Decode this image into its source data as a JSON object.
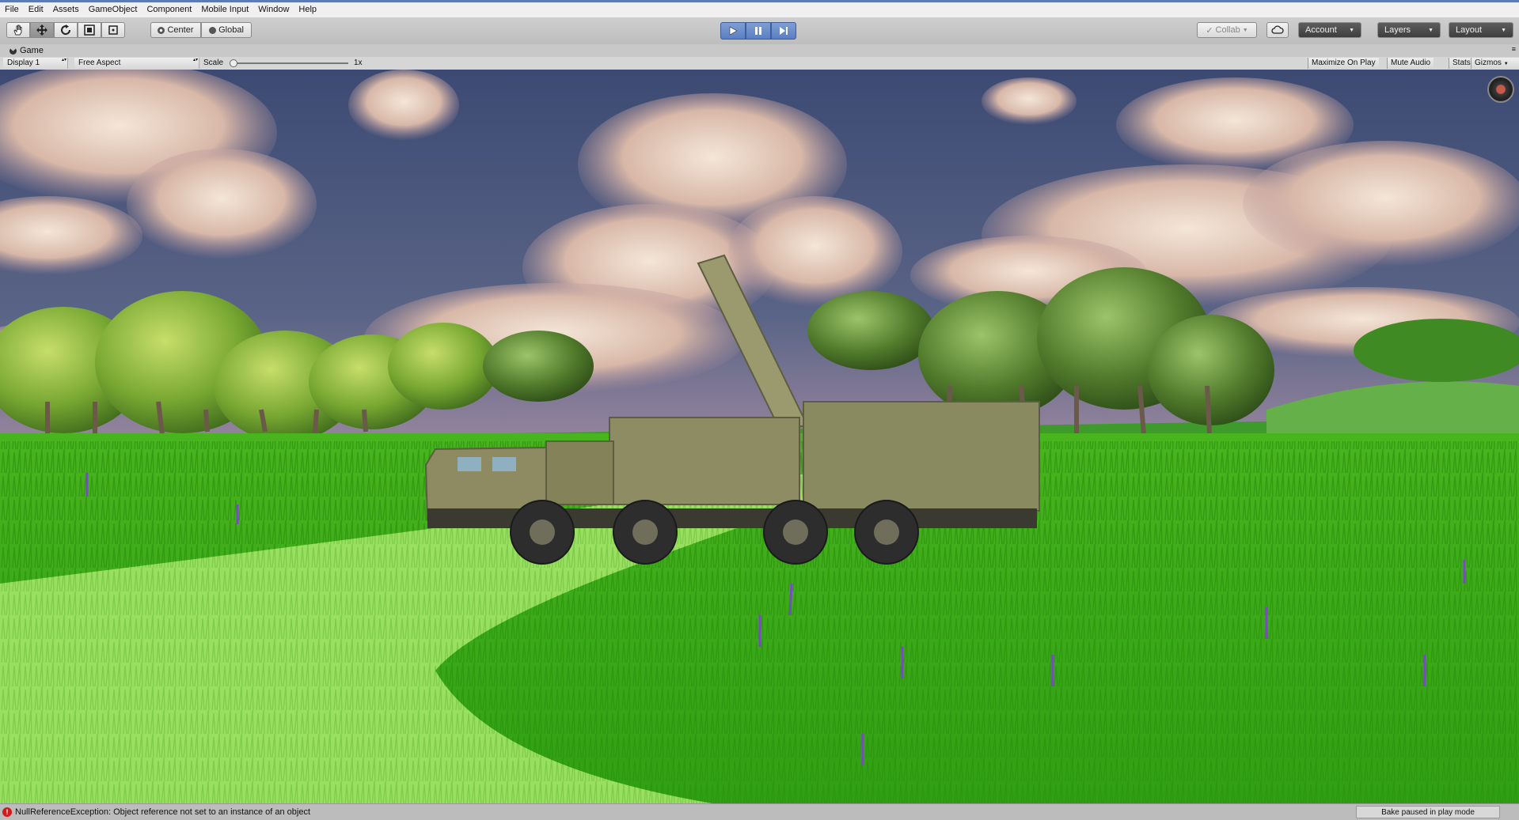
{
  "menu": [
    "File",
    "Edit",
    "Assets",
    "GameObject",
    "Component",
    "Mobile Input",
    "Window",
    "Help"
  ],
  "toolbar": {
    "tools": [
      "hand-tool-icon",
      "move-tool-icon",
      "rotate-tool-icon",
      "scale-tool-icon",
      "rect-tool-icon"
    ],
    "pivot_label": "Center",
    "space_label": "Global",
    "collab_label": "Collab",
    "account_label": "Account",
    "layers_label": "Layers",
    "layout_label": "Layout"
  },
  "game_tab": {
    "label": "Game"
  },
  "game_options": {
    "display": "Display 1",
    "aspect": "Free Aspect",
    "scale_label": "Scale",
    "scale_value": "1x",
    "scale_level": 0.0,
    "maximize_on_play": "Maximize On Play",
    "mute_audio": "Mute Audio",
    "stats": "Stats",
    "gizmos": "Gizmos"
  },
  "status": {
    "error_text": "NullReferenceException: Object reference not set to an instance of an object",
    "bake_text": "Bake paused in play mode"
  },
  "colors": {
    "sky": "#4d5a80",
    "grass": "#3cc21a",
    "path": "#9ae060",
    "truck": "#8c8c5a",
    "play_accent": "#6f8fcf",
    "error": "#d11a1a"
  }
}
